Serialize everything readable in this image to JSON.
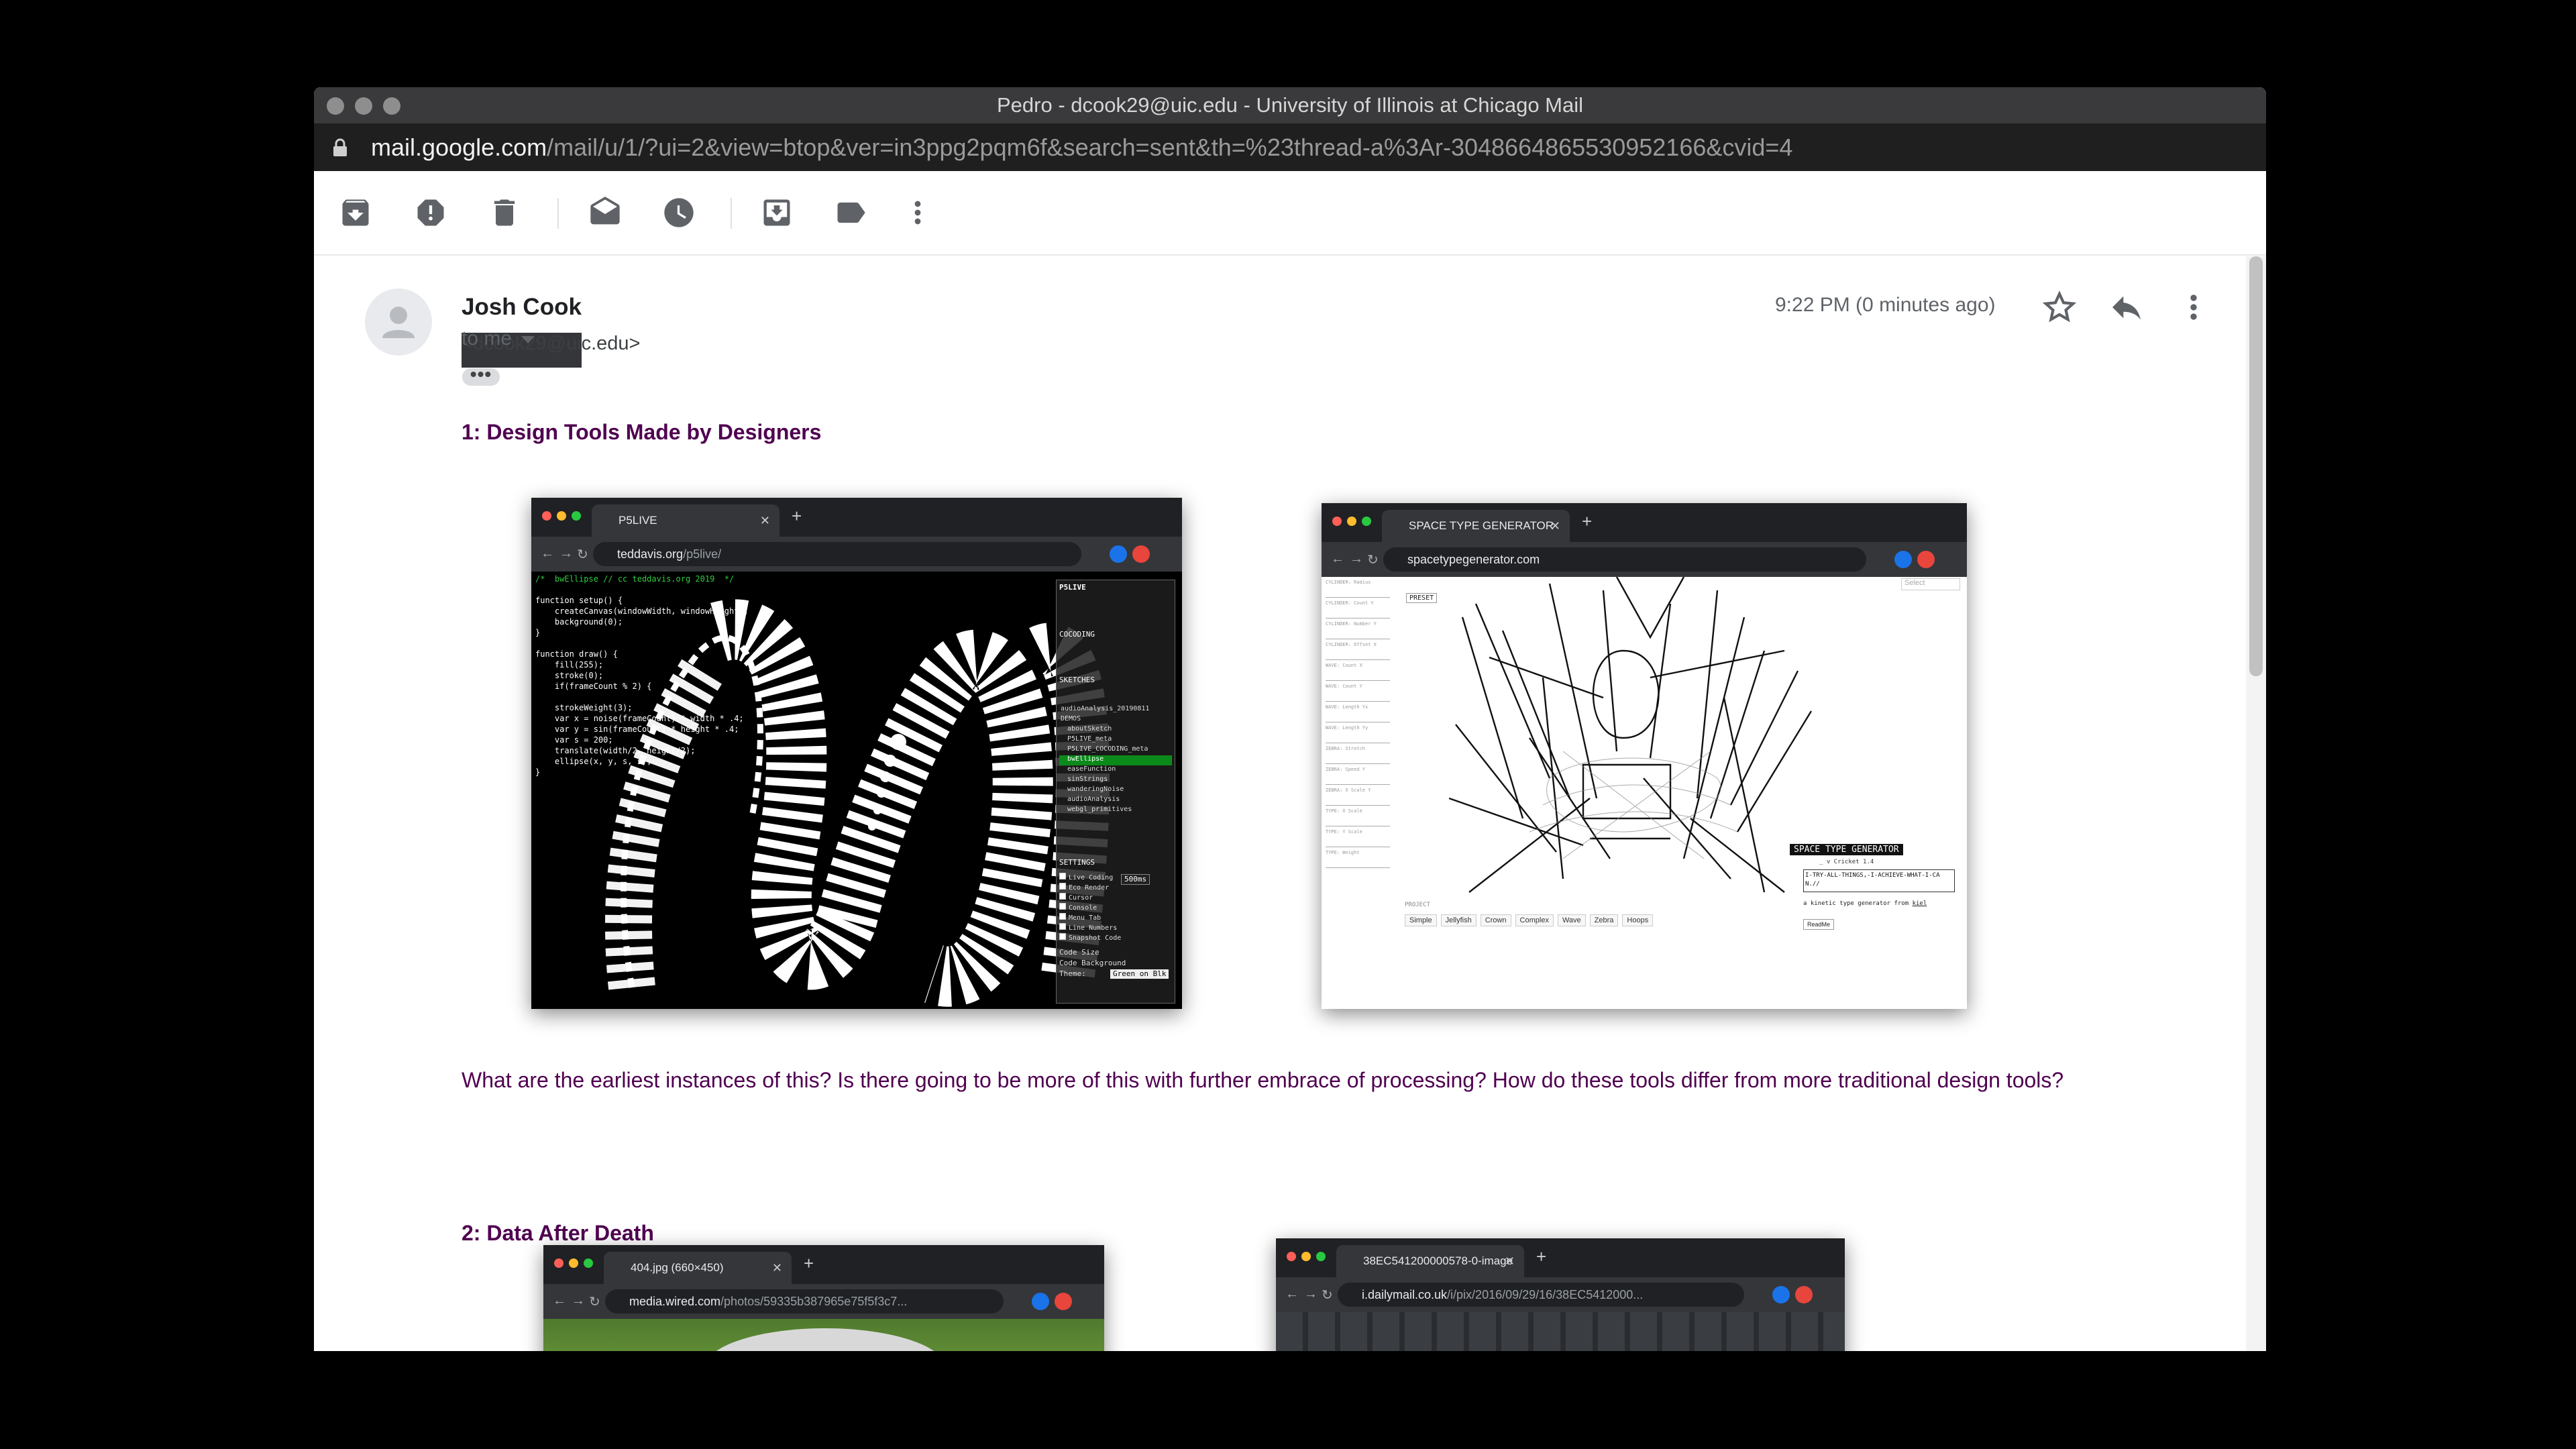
{
  "window": {
    "title": "Pedro - dcook29@uic.edu - University of Illinois at Chicago Mail",
    "url_host": "mail.google.com",
    "url_path": "/mail/u/1/?ui=2&view=btop&ver=in3ppg2pqm6f&search=sent&th=%23thread-a%3Ar-3048664865530952166&cvid=4"
  },
  "toolbar": {
    "icons": [
      "archive-icon",
      "report-spam-icon",
      "delete-icon",
      "mark-unread-icon",
      "snooze-icon",
      "move-to-inbox-icon",
      "label-icon",
      "more-vert-icon"
    ]
  },
  "email": {
    "sender_name": "Josh Cook",
    "sender_email": "<dcook29@uic.edu>",
    "to": "to me",
    "ellipsis": "•••",
    "time": "9:22 PM (0 minutes ago)",
    "section1_heading": "1: Design Tools Made by Designers",
    "paragraph1": "What are the earliest instances of this? Is there going to be more of this with further embrace of processing? How do these tools differ from more traditional design tools?",
    "section2_heading": "2: Data After Death"
  },
  "shot1": {
    "tab_title": "P5LIVE",
    "url_host": "teddavis.org",
    "url_path": "/p5live/",
    "code_lines": [
      "/*  bwEllipse // cc teddavis.org 2019  */",
      "",
      "function setup() {",
      "    createCanvas(windowWidth, windowHeight);",
      "    background(0);",
      "}",
      "",
      "function draw() {",
      "    fill(255);",
      "    stroke(0);",
      "    if(frameCount % 2) {",
      "",
      "    strokeWeight(3);",
      "    var x = noise(frameCount) * width * .4;",
      "    var y = sin(frameCount) * height * .4;",
      "    var s = 200;",
      "    translate(width/2, height/2);",
      "    ellipse(x, y, s, s);",
      "}"
    ],
    "panel_title": "P5LIVE",
    "cocoding": "COCODING",
    "sketches": "SKETCHES",
    "sketch_items": [
      "audioAnalysis_20190811",
      "DEMOS",
      "aboutSketch",
      "P5LIVE_meta",
      "P5LIVE_COCODING_meta",
      "bwEllipse",
      "easeFunction",
      "sinStrings",
      "wanderingNoise",
      "audioAnalysis",
      "webgl_primitives"
    ],
    "settings": "SETTINGS",
    "settings_items": [
      "Live Coding",
      "Eco Render",
      "Cursor",
      "Console",
      "Menu Tab",
      "Line Numbers",
      "Snapshot Code"
    ],
    "live_coding_value": "500ms",
    "code_size_label": "Code Size",
    "code_bg_label": "Code Background",
    "theme_label": "Theme:",
    "theme_value": "Green on Blk"
  },
  "shot2": {
    "tab_title": "SPACE TYPE GENERATOR",
    "url_host": "spacetypegenerator.com",
    "url_path": "",
    "left_controls": [
      "CYLINDER: Radius",
      "CYLINDER: Count Y",
      "CYLINDER: Number Y",
      "CYLINDER: Offset X",
      "WAVE: Count X",
      "WAVE: Count Y",
      "WAVE: Length Yx",
      "WAVE: Length Yy",
      "ZEBRA: Stretch",
      "ZEBRA: Speed Y",
      "ZEBRA: X Scale Y",
      "TYPE: X Scale",
      "TYPE: Y Scale",
      "TYPE: Weight"
    ],
    "preset": "PRESET",
    "select_placeholder": "Select",
    "logo": "SPACE TYPE GENERATOR",
    "logo_sub": "_ v Cricket 1.4",
    "typed_text": "I-TRY-ALL-THINGS,-I-ACHIEVE-WHAT-I-CAN.//",
    "credit_prefix": "a kinetic type generator from",
    "credit_link": "kiel",
    "project_label": "PROJECT",
    "buttons": [
      "Simple",
      "Jellyfish",
      "Crown",
      "Complex",
      "Wave",
      "Zebra",
      "Hoops"
    ],
    "readme": "ReadMe"
  },
  "shot3": {
    "tab_title": "404.jpg (660×450)",
    "url_host": "media.wired.com",
    "url_path": "/photos/59335b387965e75f5f3c7..."
  },
  "shot4": {
    "tab_title": "38EC541200000578-0-image",
    "url_host": "i.dailymail.co.uk",
    "url_path": "/i/pix/2016/09/29/16/38EC5412000..."
  },
  "colors": {
    "heading": "#500050",
    "body_text": "#500050",
    "titlebar": "#3a3a3c",
    "urlbar": "#1f1f1f",
    "avatar_badge": "#e8453c"
  }
}
